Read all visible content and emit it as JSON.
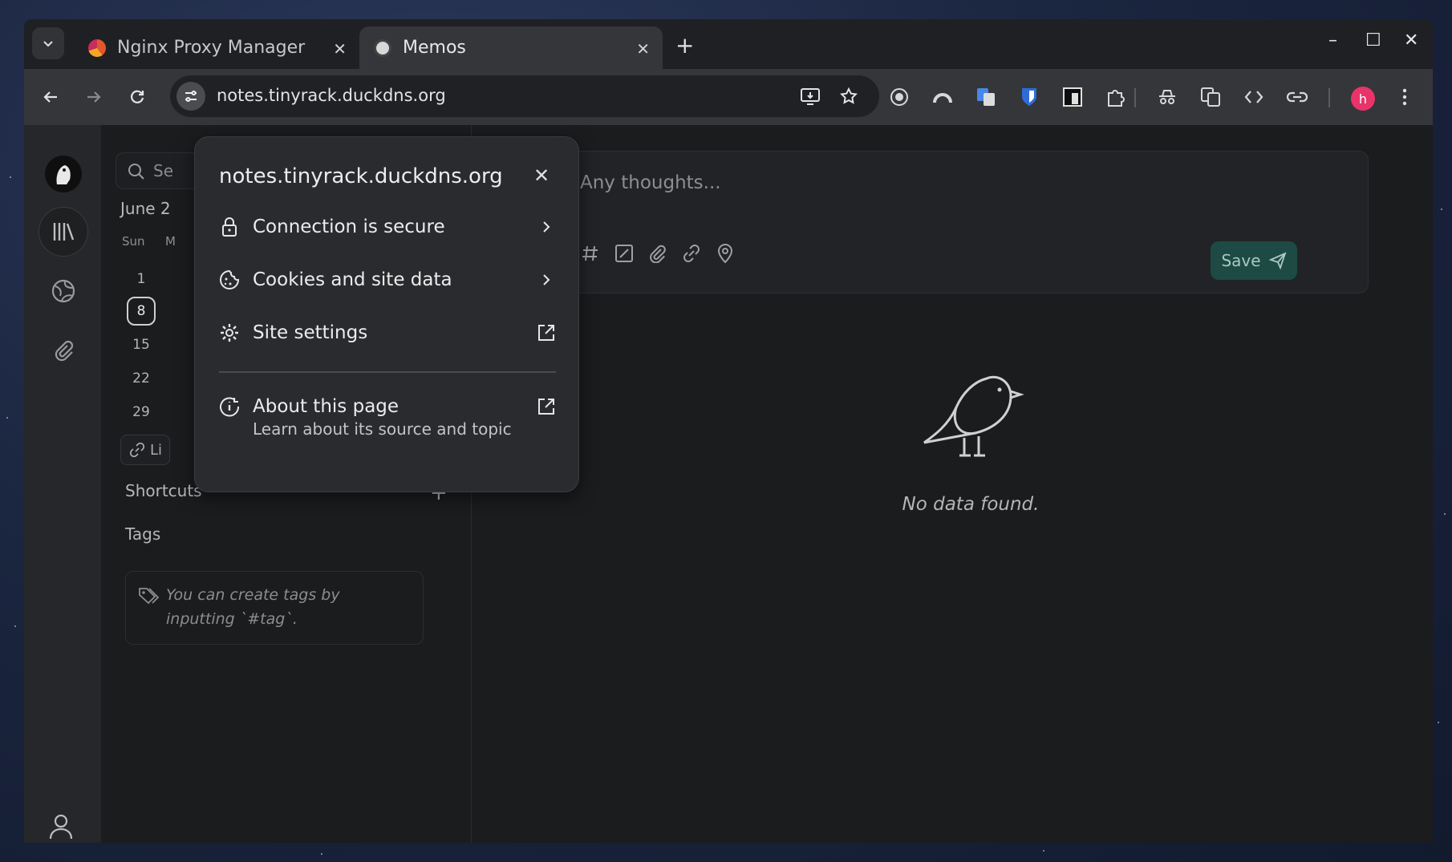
{
  "browser": {
    "tabs": [
      {
        "title": "Nginx Proxy Manager",
        "active": false,
        "favicon": "nginx-favicon"
      },
      {
        "title": "Memos",
        "active": true,
        "favicon": "memos-favicon"
      }
    ],
    "url": "notes.tinyrack.duckdns.org",
    "profile_initial": "h",
    "colors": {
      "profile": "#e8336b",
      "tab_active": "#35363a",
      "toolbar": "#35363a"
    }
  },
  "site_info_popup": {
    "domain": "notes.tinyrack.duckdns.org",
    "items": [
      {
        "label": "Connection is secure",
        "icon": "lock-icon",
        "end": "chevron-right-icon"
      },
      {
        "label": "Cookies and site data",
        "icon": "cookie-icon",
        "end": "chevron-right-icon"
      },
      {
        "label": "Site settings",
        "icon": "gear-icon",
        "end": "open-external-icon"
      }
    ],
    "about": {
      "label": "About this page",
      "sublabel": "Learn about its source and topic",
      "icon": "about-page-icon"
    }
  },
  "memos": {
    "search_placeholder": "Se",
    "calendar": {
      "month": "June 2",
      "weekday_first": "Sun",
      "weekday_second": "M",
      "days": [
        "1",
        "8",
        "15",
        "22",
        "29"
      ],
      "today": "8"
    },
    "link_chip": "Li",
    "shortcuts_title": "Shortcuts",
    "tags_title": "Tags",
    "tags_hint": "You can create tags by inputting `#tag`.",
    "editor_placeholder": "Any thoughts...",
    "save_label": "Save",
    "empty_text": "No data found.",
    "colors": {
      "save_bg": "#1d4a45",
      "page_bg": "#1b1c1e"
    }
  }
}
